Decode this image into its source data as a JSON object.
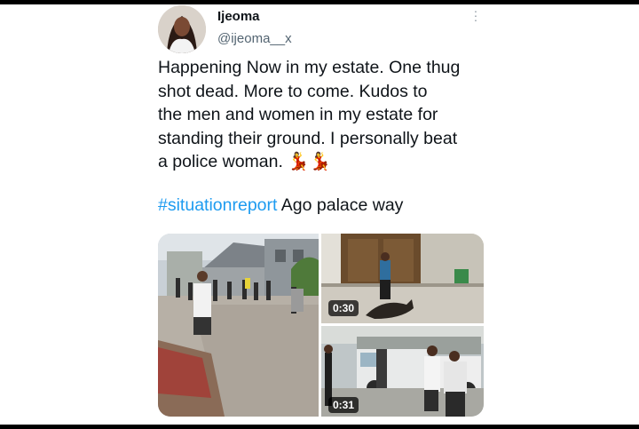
{
  "tweet": {
    "author_name": "Ijeoma",
    "author_handle": "@ijeoma__x",
    "text_lines": [
      "Happening Now in my estate. One thug",
      "shot dead. More to come. Kudos to",
      "the men and women in my estate for",
      "standing their ground. I personally beat",
      "a police woman. 💃💃"
    ],
    "hashtag": "#situationreport",
    "location_text": " Ago palace way",
    "more_icon": "vertical-ellipsis-icon",
    "accent_color": "#1d9bf0"
  },
  "media": {
    "videos": [
      {
        "duration": "0:30"
      },
      {
        "duration": "0:31"
      }
    ]
  }
}
